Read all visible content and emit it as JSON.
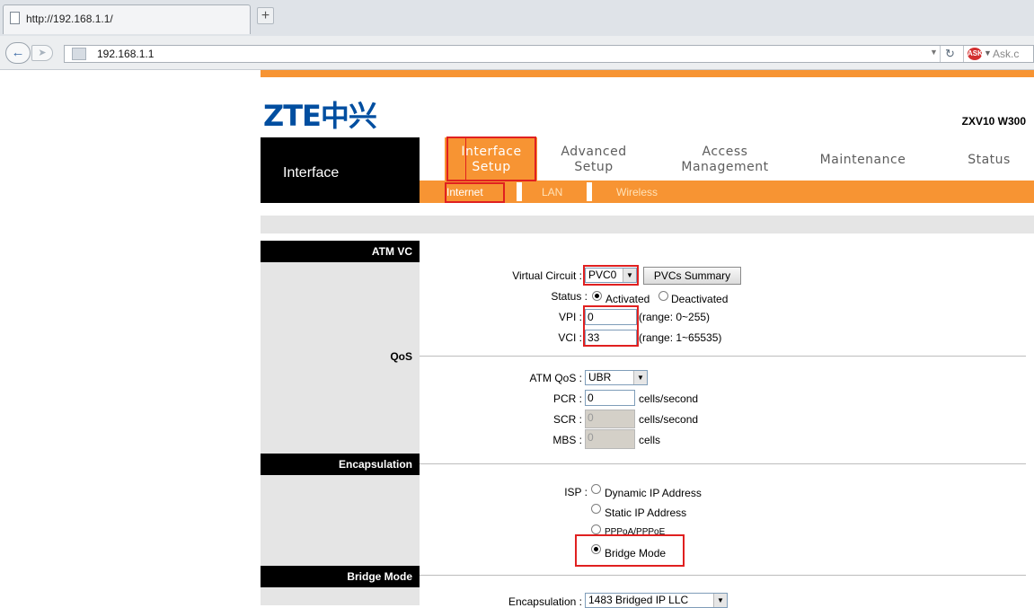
{
  "browser": {
    "tab_title": "http://192.168.1.1/",
    "new_tab": "+",
    "url": "192.168.1.1",
    "search_engine": "Ask.c"
  },
  "router": {
    "brand": "ZTE中兴",
    "model": "ZXV10 W300",
    "side_title": "Interface",
    "menu": [
      {
        "line1": "Interface",
        "line2": "Setup"
      },
      {
        "line1": "Advanced",
        "line2": "Setup"
      },
      {
        "line1": "Access",
        "line2": "Management"
      },
      {
        "line1": "Maintenance",
        "line2": ""
      },
      {
        "line1": "Status",
        "line2": ""
      }
    ],
    "submenu": [
      "Internet",
      "LAN",
      "Wireless"
    ]
  },
  "sections": {
    "atm_vc": "ATM VC",
    "qos": "QoS",
    "encapsulation": "Encapsulation",
    "bridge_mode": "Bridge Mode"
  },
  "atm": {
    "virtual_circuit_label": "Virtual Circuit :",
    "virtual_circuit_value": "PVC0",
    "pvcs_summary_button": "PVCs Summary",
    "status_label": "Status :",
    "status_activated": "Activated",
    "status_deactivated": "Deactivated",
    "vpi_label": "VPI :",
    "vpi_value": "0",
    "vpi_range": "(range: 0~255)",
    "vci_label": "VCI :",
    "vci_value": "33",
    "vci_range": "(range: 1~65535)"
  },
  "qos": {
    "atm_qos_label": "ATM QoS :",
    "atm_qos_value": "UBR",
    "pcr_label": "PCR :",
    "pcr_value": "0",
    "pcr_unit": "cells/second",
    "scr_label": "SCR :",
    "scr_value": "0",
    "scr_unit": "cells/second",
    "mbs_label": "MBS :",
    "mbs_value": "0",
    "mbs_unit": "cells"
  },
  "isp": {
    "label": "ISP :",
    "options": [
      "Dynamic IP Address",
      "Static IP Address",
      "PPPoA/PPPoE",
      "Bridge Mode"
    ],
    "selected": "Bridge Mode"
  },
  "bridge": {
    "encapsulation_label": "Encapsulation :",
    "encapsulation_value": "1483 Bridged IP LLC"
  }
}
